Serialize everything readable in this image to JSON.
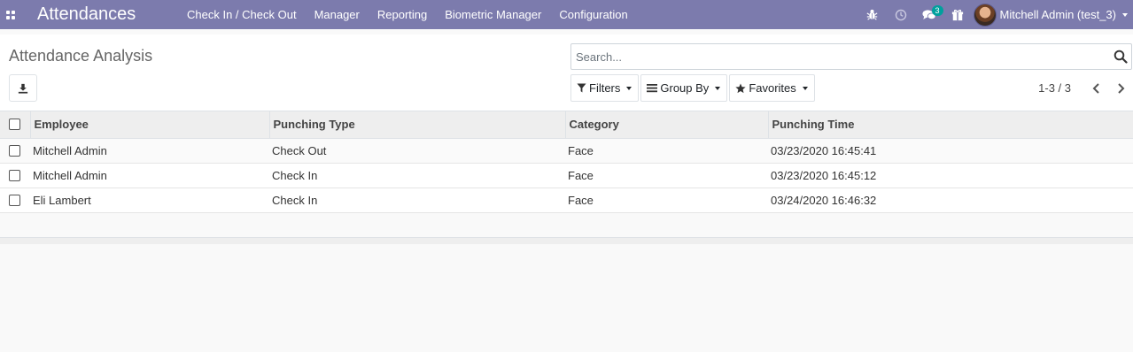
{
  "navbar": {
    "app_title": "Attendances",
    "menu": [
      "Check In / Check Out",
      "Manager",
      "Reporting",
      "Biometric Manager",
      "Configuration"
    ],
    "messages_badge": "3",
    "user_name": "Mitchell Admin (test_3)"
  },
  "control_panel": {
    "breadcrumb": "Attendance Analysis",
    "search_placeholder": "Search...",
    "filters_label": "Filters",
    "group_by_label": "Group By",
    "favorites_label": "Favorites",
    "pager_value": "1-3 / 3"
  },
  "list": {
    "columns": [
      "Employee",
      "Punching Type",
      "Category",
      "Punching Time"
    ],
    "rows": [
      {
        "employee": "Mitchell Admin",
        "punching_type": "Check Out",
        "category": "Face",
        "punching_time": "03/23/2020 16:45:41"
      },
      {
        "employee": "Mitchell Admin",
        "punching_type": "Check In",
        "category": "Face",
        "punching_time": "03/23/2020 16:45:12"
      },
      {
        "employee": "Eli Lambert",
        "punching_type": "Check In",
        "category": "Face",
        "punching_time": "03/24/2020 16:46:32"
      }
    ]
  },
  "colors": {
    "navbar": "#7c7bad",
    "badge": "#00a09d"
  }
}
